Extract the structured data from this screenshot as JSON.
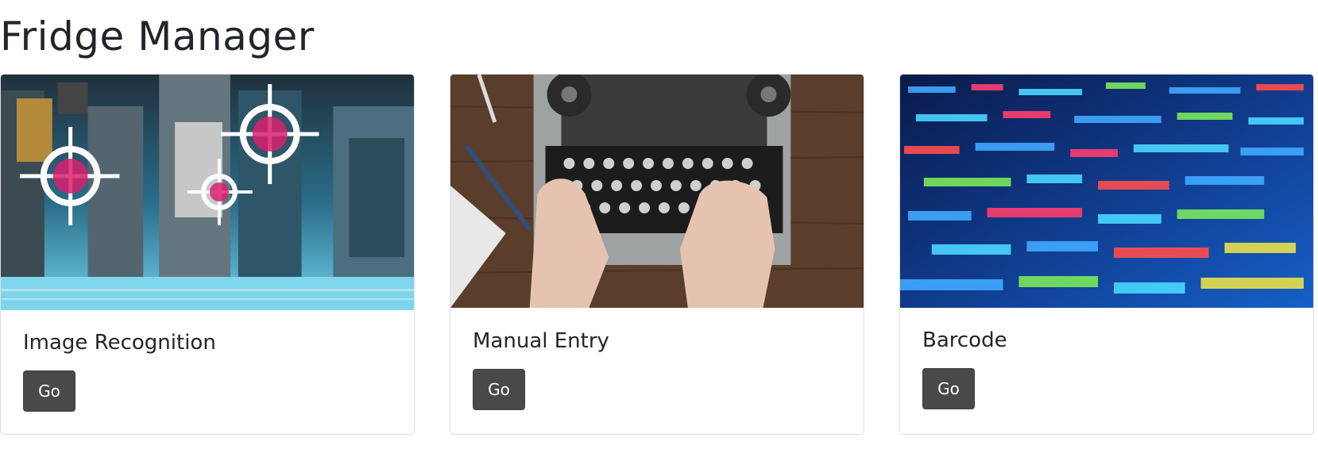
{
  "header": {
    "title": "Fridge Manager"
  },
  "cards": [
    {
      "title": "Image Recognition",
      "button_label": "Go",
      "image": "city-street-with-recognition-targets"
    },
    {
      "title": "Manual Entry",
      "button_label": "Go",
      "image": "hands-typing-on-typewriter"
    },
    {
      "title": "Barcode",
      "button_label": "Go",
      "image": "colorful-code-on-screen"
    }
  ],
  "colors": {
    "button_bg": "#494949",
    "button_text": "#ffffff",
    "title_text": "#212529"
  }
}
